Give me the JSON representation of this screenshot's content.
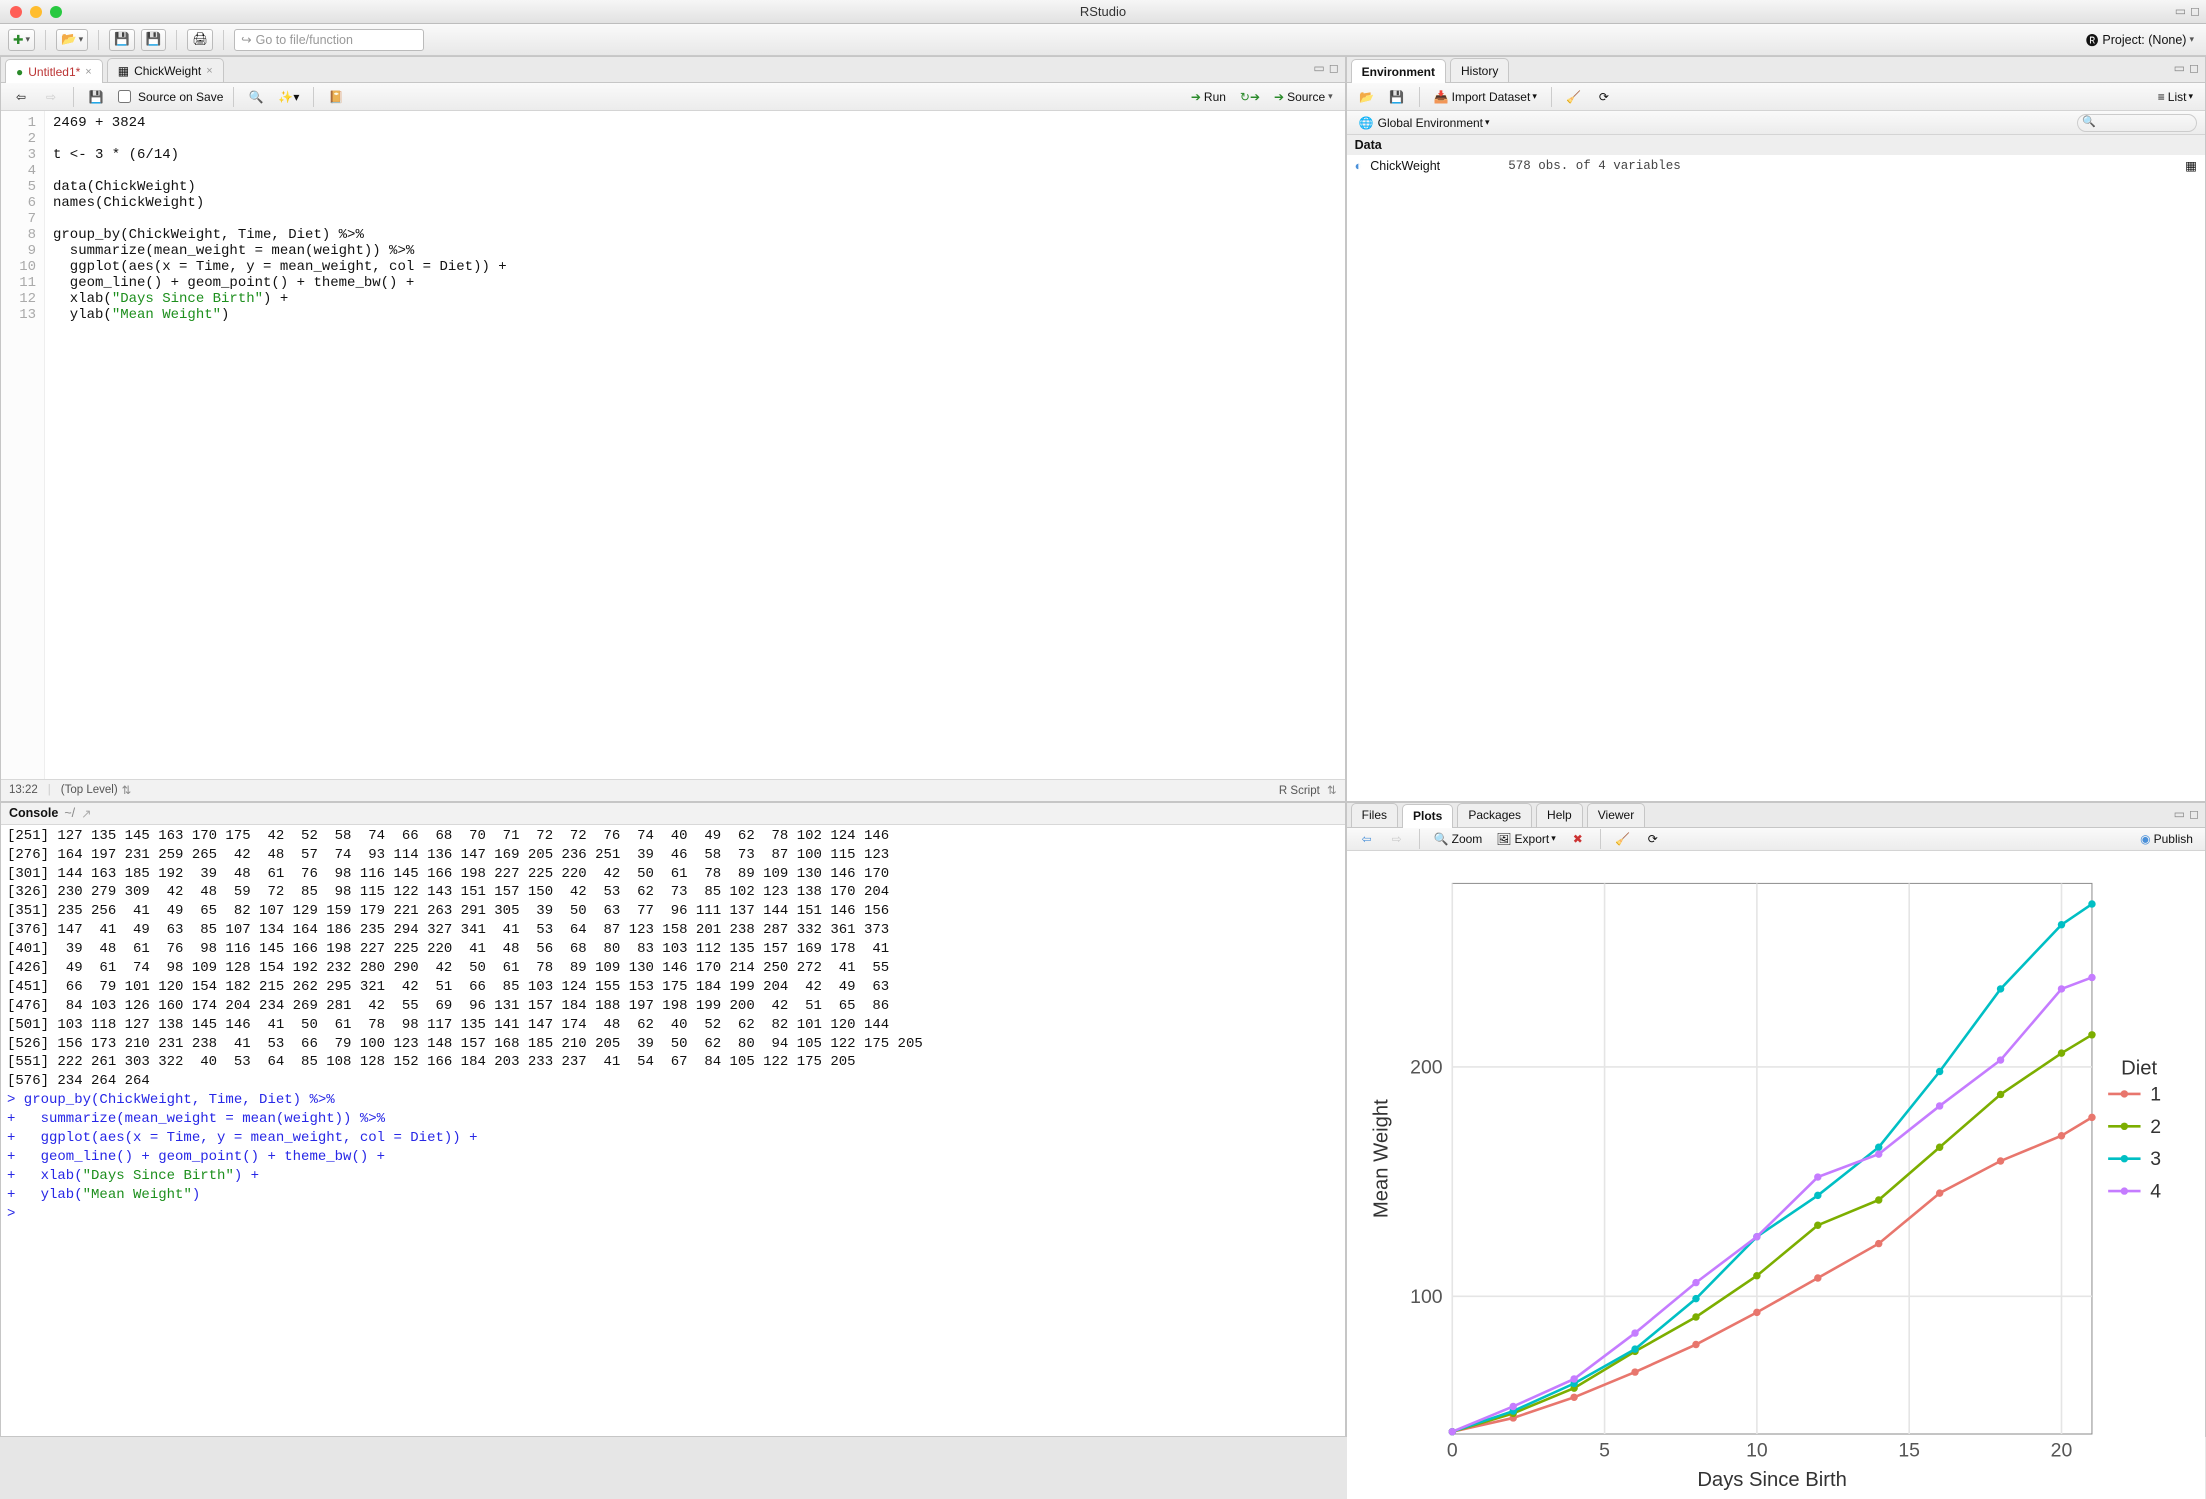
{
  "window": {
    "title": "RStudio"
  },
  "mainToolbar": {
    "goto_placeholder": "Go to file/function",
    "project_label": "Project: (None)"
  },
  "sourceTabs": [
    {
      "icon": "rfile",
      "label": "Untitled1*",
      "active": true
    },
    {
      "icon": "table",
      "label": "ChickWeight",
      "active": false
    }
  ],
  "sourceToolbar": {
    "source_on_save": "Source on Save",
    "run": "Run",
    "source": "Source"
  },
  "editor": {
    "cursor": "13:22",
    "scope": "(Top Level)",
    "lang": "R Script",
    "lines": [
      "2469 + 3824",
      "",
      "t <- 3 * (6/14)",
      "",
      "data(ChickWeight)",
      "names(ChickWeight)",
      "",
      "group_by(ChickWeight, Time, Diet) %>%",
      "  summarize(mean_weight = mean(weight)) %>%",
      "  ggplot(aes(x = Time, y = mean_weight, col = Diet)) +",
      "  geom_line() + geom_point() + theme_bw() +",
      "  xlab(\"Days Since Birth\") +",
      "  ylab(\"Mean Weight\")"
    ]
  },
  "console": {
    "title": "Console",
    "cwd": "~/",
    "output_rows": [
      "[251] 127 135 145 163 170 175  42  52  58  74  66  68  70  71  72  72  76  74  40  49  62  78 102 124 146",
      "[276] 164 197 231 259 265  42  48  57  74  93 114 136 147 169 205 236 251  39  46  58  73  87 100 115 123",
      "[301] 144 163 185 192  39  48  61  76  98 116 145 166 198 227 225 220  42  50  61  78  89 109 130 146 170",
      "[326] 230 279 309  42  48  59  72  85  98 115 122 143 151 157 150  42  53  62  73  85 102 123 138 170 204",
      "[351] 235 256  41  49  65  82 107 129 159 179 221 263 291 305  39  50  63  77  96 111 137 144 151 146 156",
      "[376] 147  41  49  63  85 107 134 164 186 235 294 327 341  41  53  64  87 123 158 201 238 287 332 361 373",
      "[401]  39  48  61  76  98 116 145 166 198 227 225 220  41  48  56  68  80  83 103 112 135 157 169 178  41",
      "[426]  49  61  74  98 109 128 154 192 232 280 290  42  50  61  78  89 109 130 146 170 214 250 272  41  55",
      "[451]  66  79 101 120 154 182 215 262 295 321  42  51  66  85 103 124 155 153 175 184 199 204  42  49  63",
      "[476]  84 103 126 160 174 204 234 269 281  42  55  69  96 131 157 184 188 197 198 199 200  42  51  65  86",
      "[501] 103 118 127 138 145 146  41  50  61  78  98 117 135 141 147 174  48  62  40  52  62  82 101 120 144",
      "[526] 156 173 210 231 238  41  53  66  79 100 123 148 157 168 185 210 205  39  50  62  80  94 105 122 175 205",
      "[551] 222 261 303 322  40  53  64  85 108 128 152 166 184 203 233 237  41  54  67  84 105 122 175 205",
      "[576] 234 264 264"
    ],
    "echo_lines": [
      "> group_by(ChickWeight, Time, Diet) %>%",
      "+   summarize(mean_weight = mean(weight)) %>%",
      "+   ggplot(aes(x = Time, y = mean_weight, col = Diet)) +",
      "+   geom_line() + geom_point() + theme_bw() +",
      "+   xlab(\"Days Since Birth\") +",
      "+   ylab(\"Mean Weight\")",
      "> "
    ]
  },
  "envTabs": {
    "env": "Environment",
    "hist": "History"
  },
  "envToolbar": {
    "import": "Import Dataset",
    "list": "List",
    "scope": "Global Environment"
  },
  "envData": {
    "header": "Data",
    "items": [
      {
        "name": "ChickWeight",
        "desc": "578 obs. of 4 variables"
      }
    ]
  },
  "bottomTabs": {
    "files": "Files",
    "plots": "Plots",
    "packages": "Packages",
    "help": "Help",
    "viewer": "Viewer"
  },
  "plotToolbar": {
    "zoom": "Zoom",
    "export": "Export",
    "publish": "Publish"
  },
  "chart_data": {
    "type": "line",
    "title": "",
    "xlabel": "Days Since Birth",
    "ylabel": "Mean Weight",
    "legend_title": "Diet",
    "xlim": [
      0,
      21
    ],
    "ylim": [
      40,
      280
    ],
    "xticks": [
      0,
      5,
      10,
      15,
      20
    ],
    "yticks": [
      100,
      200
    ],
    "x": [
      0,
      2,
      4,
      6,
      8,
      10,
      12,
      14,
      16,
      18,
      20,
      21
    ],
    "series": [
      {
        "name": "1",
        "color": "#e8766d",
        "values": [
          41,
          47,
          56,
          67,
          79,
          93,
          108,
          123,
          145,
          159,
          170,
          178
        ]
      },
      {
        "name": "2",
        "color": "#7cae00",
        "values": [
          41,
          49,
          60,
          76,
          91,
          109,
          131,
          142,
          165,
          188,
          206,
          214
        ]
      },
      {
        "name": "3",
        "color": "#00bfc4",
        "values": [
          41,
          50,
          62,
          77,
          99,
          126,
          144,
          165,
          198,
          234,
          262,
          271
        ]
      },
      {
        "name": "4",
        "color": "#c57cff",
        "values": [
          41,
          52,
          64,
          84,
          106,
          126,
          152,
          162,
          183,
          203,
          234,
          239
        ]
      }
    ]
  }
}
